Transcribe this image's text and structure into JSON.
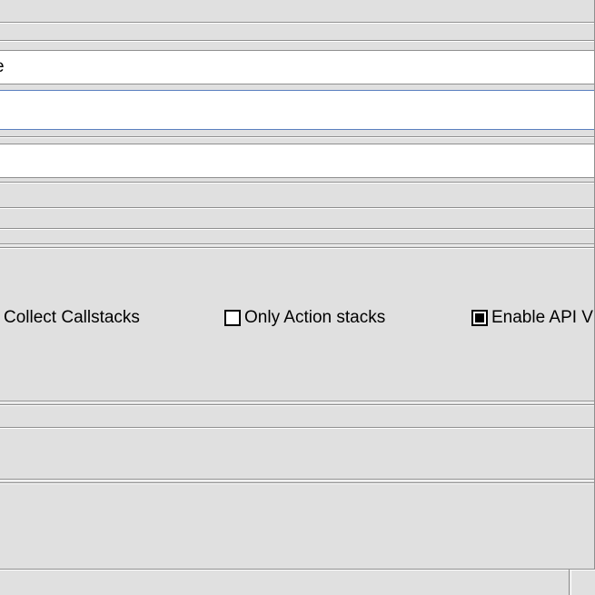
{
  "fields": {
    "field1_visible_fragment": "e"
  },
  "checkboxes": {
    "collect_callstacks": {
      "label": "Collect Callstacks",
      "checked": false
    },
    "only_action_stacks": {
      "label": "Only Action stacks",
      "checked": false
    },
    "enable_api_fragment": {
      "label": "Enable API V",
      "checked": true
    }
  }
}
